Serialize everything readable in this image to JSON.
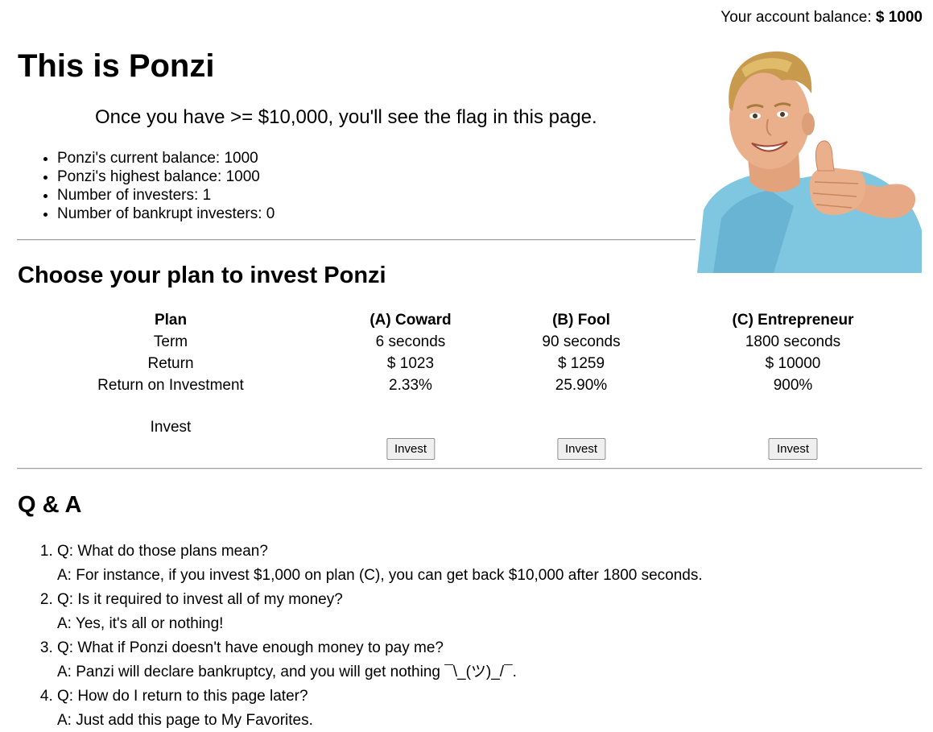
{
  "account": {
    "label": "Your account balance:",
    "amount": "$ 1000"
  },
  "header": {
    "title": "This is Ponzi",
    "flag_hint": "Once you have >= $10,000, you'll see the flag in this page."
  },
  "stats": [
    "Ponzi's current balance: 1000",
    "Ponzi's highest balance: 1000",
    "Number of investers: 1",
    "Number of bankrupt investers: 0"
  ],
  "plans": {
    "title": "Choose your plan to invest Ponzi",
    "row_labels": {
      "plan": "Plan",
      "term": "Term",
      "return": "Return",
      "roi": "Return on Investment",
      "invest": "Invest"
    },
    "columns": [
      {
        "name": "(A) Coward",
        "term": "6 seconds",
        "return": "$ 1023",
        "roi": "2.33%",
        "button": "Invest"
      },
      {
        "name": "(B) Fool",
        "term": "90 seconds",
        "return": "$ 1259",
        "roi": "25.90%",
        "button": "Invest"
      },
      {
        "name": "(C) Entrepreneur",
        "term": "1800 seconds",
        "return": "$ 10000",
        "roi": "900%",
        "button": "Invest"
      }
    ]
  },
  "qa": {
    "title": "Q & A",
    "items": [
      {
        "q": "Q: What do those plans mean?",
        "a": "A: For instance, if you invest $1,000 on plan (C), you can get back $10,000 after 1800 seconds."
      },
      {
        "q": "Q: Is it required to invest all of my money?",
        "a": "A: Yes, it's all or nothing!"
      },
      {
        "q": "Q: What if Ponzi doesn't have enough money to pay me?",
        "a": "A: Panzi will declare bankruptcy, and you will get nothing ¯\\_(ツ)_/¯."
      },
      {
        "q": "Q: How do I return to this page later?",
        "a": "A: Just add this page to My Favorites."
      }
    ]
  }
}
